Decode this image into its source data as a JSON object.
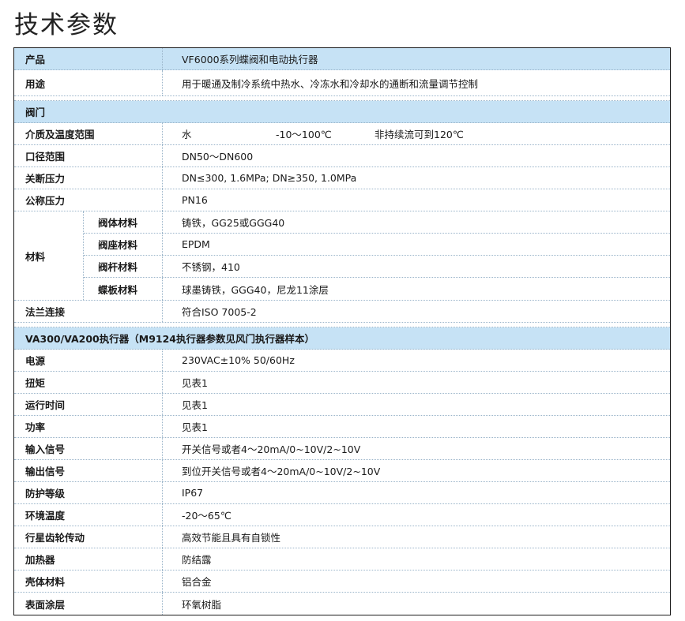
{
  "page": {
    "title": "技术参数"
  },
  "table": {
    "product": {
      "label": "产品",
      "value": "VF6000系列蝶阀和电动执行器"
    },
    "usage": {
      "label": "用途",
      "value": "用于暖通及制冷系统中热水、冷冻水和冷却水的通断和流量调节控制"
    },
    "valve_section": {
      "label": "阀门"
    },
    "medium": {
      "label": "介质及温度范围",
      "part1": "水",
      "part2": "-10～100℃",
      "part3": "非持续流可到120℃"
    },
    "diameter": {
      "label": "口径范围",
      "value": "DN50～DN600"
    },
    "shutoff": {
      "label": "关断压力",
      "value": "DN≤300, 1.6MPa; DN≥350, 1.0MPa"
    },
    "nominal": {
      "label": "公称压力",
      "value": "PN16"
    },
    "material": {
      "label": "材料",
      "items": [
        {
          "label": "阀体材料",
          "value": "铸铁，GG25或GGG40"
        },
        {
          "label": "阀座材料",
          "value": "EPDM"
        },
        {
          "label": "阀杆材料",
          "value": "不锈钢，410"
        },
        {
          "label": "蝶板材料",
          "value": "球墨铸铁，GGG40，尼龙11涂层"
        }
      ]
    },
    "flange": {
      "label": "法兰连接",
      "value": "符合ISO 7005-2"
    },
    "actuator_section": {
      "label": "VA300/VA200执行器（M9124执行器参数见风门执行器样本）"
    },
    "actuator_rows": [
      {
        "label": "电源",
        "value": "230VAC±10%  50/60Hz"
      },
      {
        "label": "扭矩",
        "value": "见表1"
      },
      {
        "label": "运行时间",
        "value": "见表1"
      },
      {
        "label": "功率",
        "value": "见表1"
      },
      {
        "label": "输入信号",
        "value": "开关信号或者4～20mA/0~10V/2~10V"
      },
      {
        "label": "输出信号",
        "value": "到位开关信号或者4～20mA/0~10V/2~10V"
      },
      {
        "label": "防护等级",
        "value": "IP67"
      },
      {
        "label": "环境温度",
        "value": "-20～65℃"
      },
      {
        "label": "行星齿轮传动",
        "value": "高效节能且具有自锁性"
      },
      {
        "label": "加热器",
        "value": "防结露"
      },
      {
        "label": "壳体材料",
        "value": "铝合金"
      },
      {
        "label": "表面涂层",
        "value": "环氧树脂"
      }
    ]
  },
  "colors": {
    "header_blue": "#c6e2f5",
    "border": "#1a1a1a",
    "divider": "#9ab4c9"
  }
}
